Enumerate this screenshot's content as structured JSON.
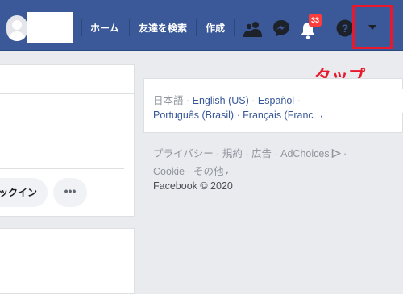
{
  "header": {
    "nav": {
      "home": "ホーム",
      "find_friends": "友達を検索",
      "create": "作成"
    },
    "notification_count": "33",
    "icons": [
      "friends-icon",
      "messenger-icon",
      "bell-icon",
      "help-icon",
      "dropdown-arrow-icon"
    ],
    "brand_color": "#3b5998"
  },
  "annotation": {
    "label": "タップ",
    "color": "#e8192c"
  },
  "feed": {
    "like_label": "ックイン",
    "more_label": "•••"
  },
  "languages": {
    "current": "日本語",
    "sep": " · ",
    "items": [
      "English (US)",
      "Español",
      "Português (Brasil)",
      "Français (Franc"
    ]
  },
  "footer": {
    "privacy": "プライバシー",
    "terms": "規約",
    "ads": "広告",
    "adchoices": "AdChoices",
    "cookie": "Cookie",
    "more": "その他",
    "copyright": "Facebook © 2020"
  }
}
